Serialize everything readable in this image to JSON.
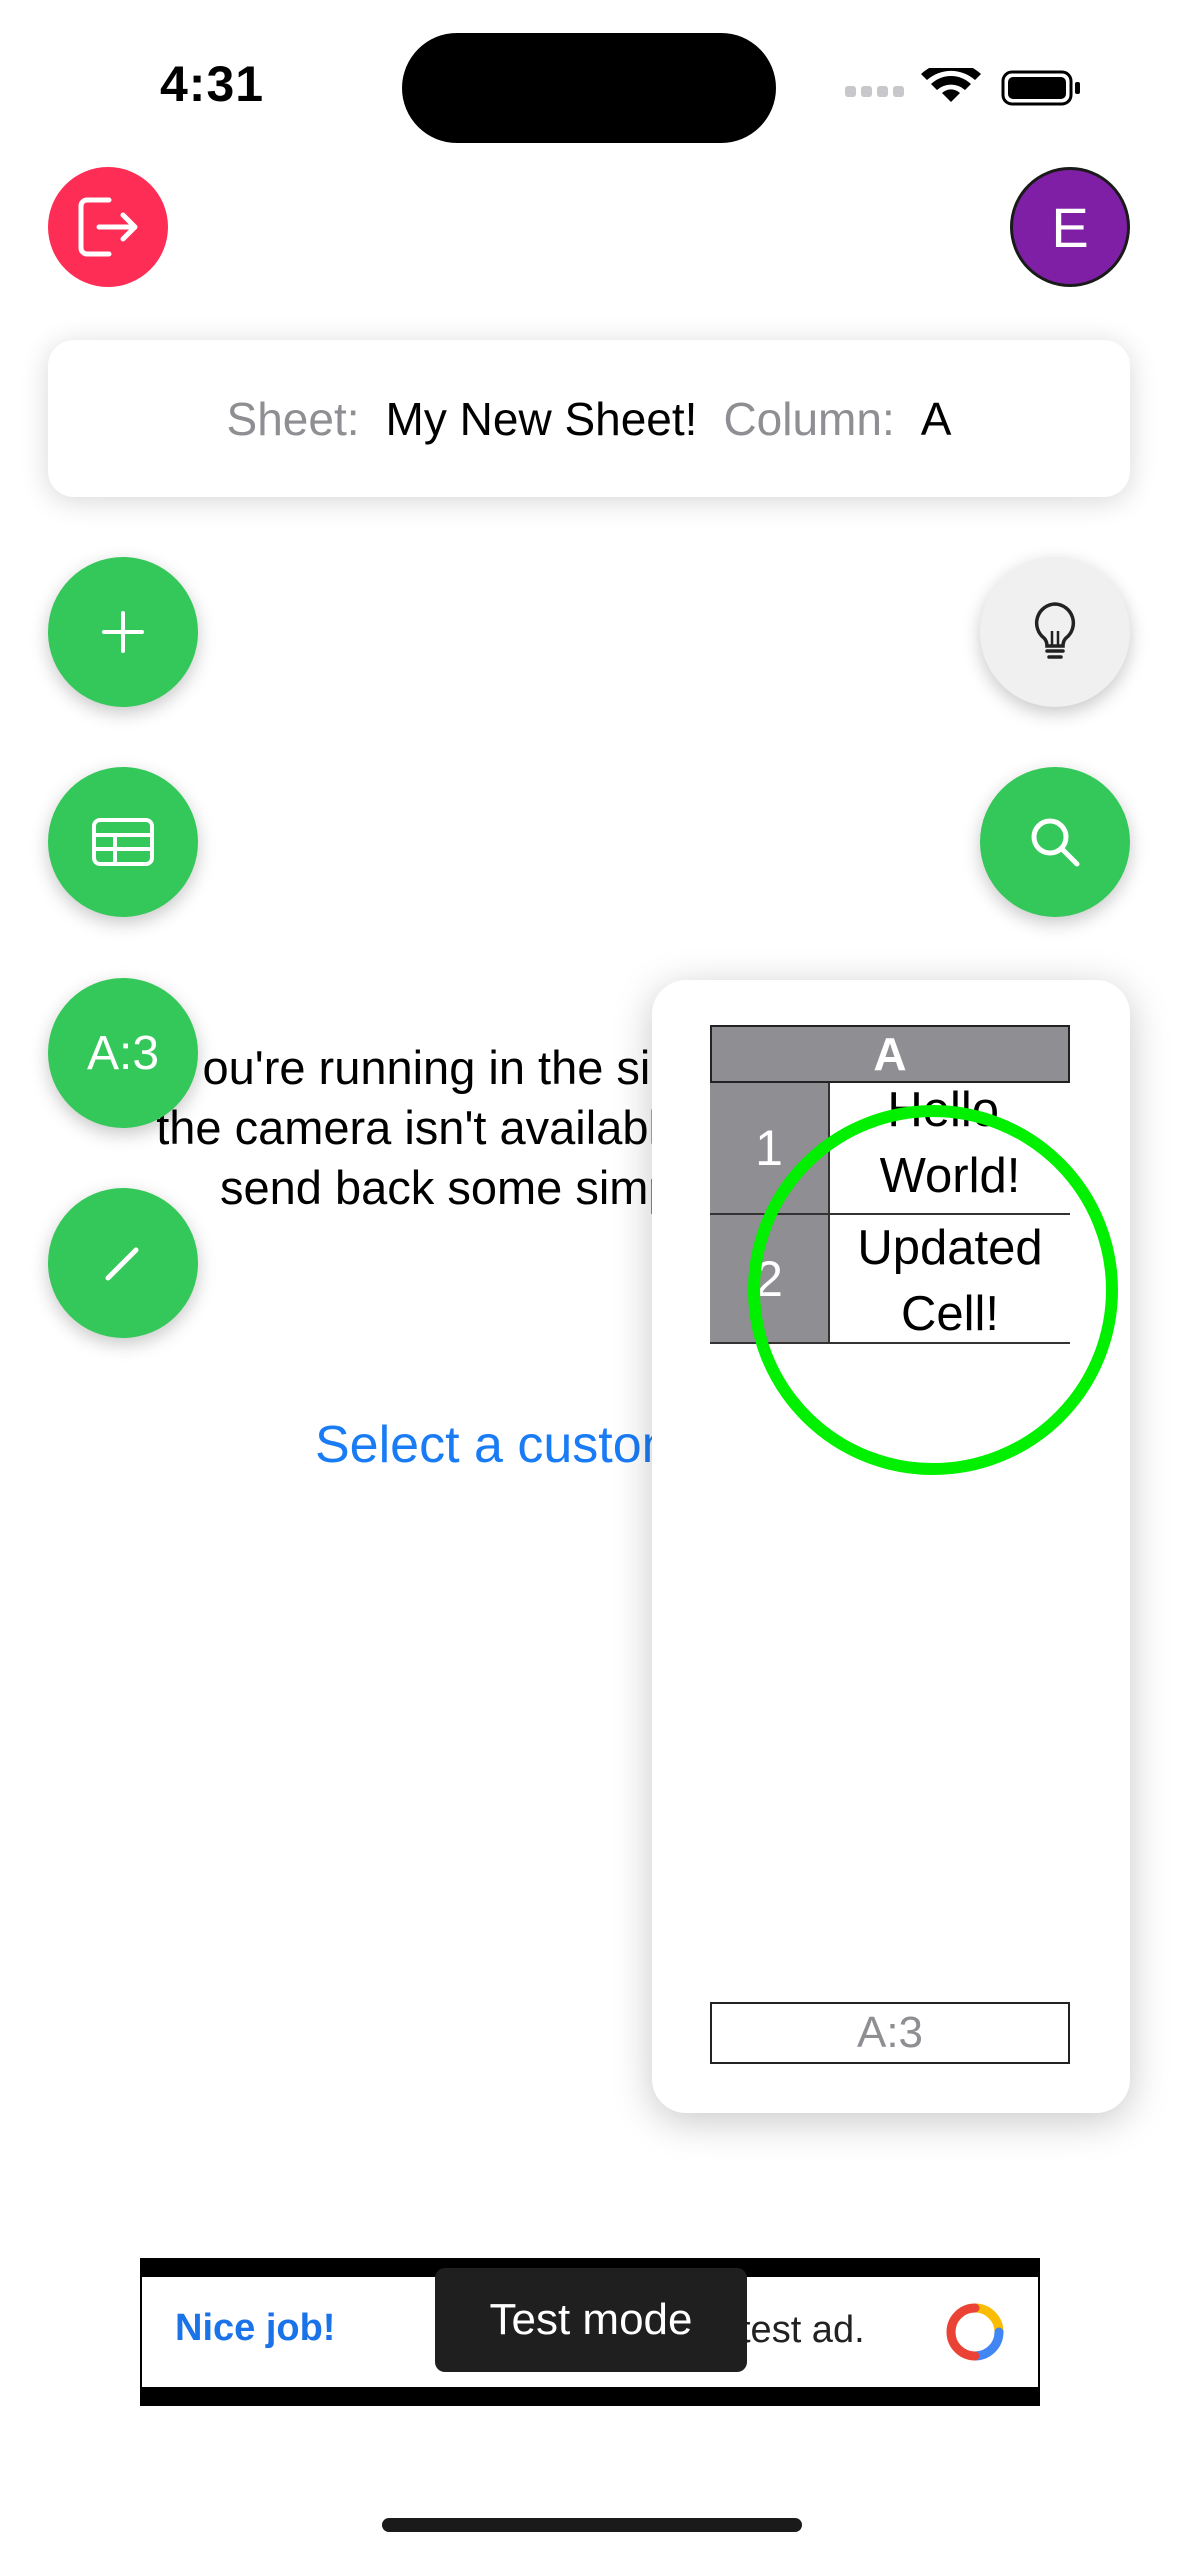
{
  "status_bar": {
    "time": "4:31"
  },
  "header": {
    "avatar_initial": "E"
  },
  "info": {
    "sheet_label": "Sheet:",
    "sheet_name": "My New Sheet!",
    "column_label": "Column:",
    "column_value": "A"
  },
  "fabs": {
    "cell_ref": "A:3"
  },
  "background": {
    "message_lines": [
      "ou're running in the simulator,",
      "the camera isn't available, so we'll",
      "send back some simple text"
    ],
    "link_text": "Select a custom"
  },
  "grid": {
    "column_header": "A",
    "rows": [
      {
        "num": "1",
        "value": "Hello, World!"
      },
      {
        "num": "2",
        "value": "Updated Cell!"
      }
    ],
    "cell_input": "A:3"
  },
  "ad": {
    "nice": "Nice job!",
    "text": "test ad.",
    "toast": "Test mode"
  },
  "colors": {
    "accent_green": "#34c759",
    "logout_red": "#fd2d55",
    "avatar_purple": "#7e1fa5",
    "highlight": "#00f000"
  }
}
